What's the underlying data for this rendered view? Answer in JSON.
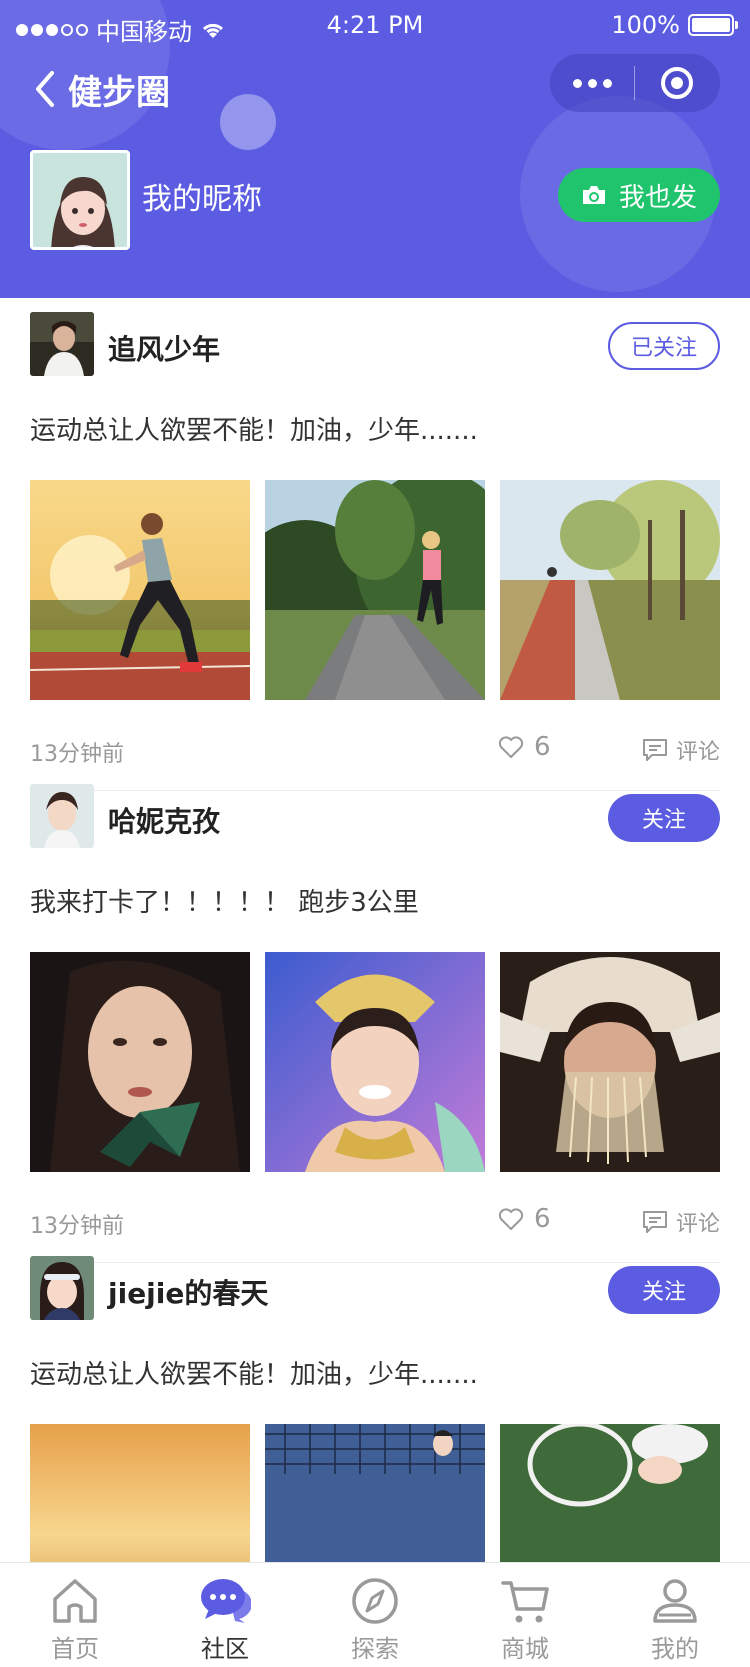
{
  "status_bar": {
    "carrier": "中国移动",
    "time": "4:21 PM",
    "battery": "100%"
  },
  "nav": {
    "title": "健步圈"
  },
  "profile": {
    "nickname": "我的昵称",
    "post_button": "我也发"
  },
  "posts": [
    {
      "user": "追风少年",
      "follow_label": "已关注",
      "followed": true,
      "text": "运动总让人欲罢不能！加油，少年.......",
      "time": "13分钟前",
      "likes": "6",
      "comment_label": "评论"
    },
    {
      "user": "哈妮克孜",
      "follow_label": "关注",
      "followed": false,
      "text": "我来打卡了！！！！！ 跑步3公里",
      "time": "13分钟前",
      "likes": "6",
      "comment_label": "评论"
    },
    {
      "user": "jiejie的春天",
      "follow_label": "关注",
      "followed": false,
      "text": "运动总让人欲罢不能！加油，少年......."
    }
  ],
  "tabbar": {
    "items": [
      {
        "label": "首页",
        "icon": "home-icon"
      },
      {
        "label": "社区",
        "icon": "community-icon"
      },
      {
        "label": "探索",
        "icon": "compass-icon"
      },
      {
        "label": "商城",
        "icon": "cart-icon"
      },
      {
        "label": "我的",
        "icon": "person-icon"
      }
    ],
    "active": "社区"
  },
  "colors": {
    "primary": "#5b5ce2",
    "green": "#1fc46c"
  }
}
